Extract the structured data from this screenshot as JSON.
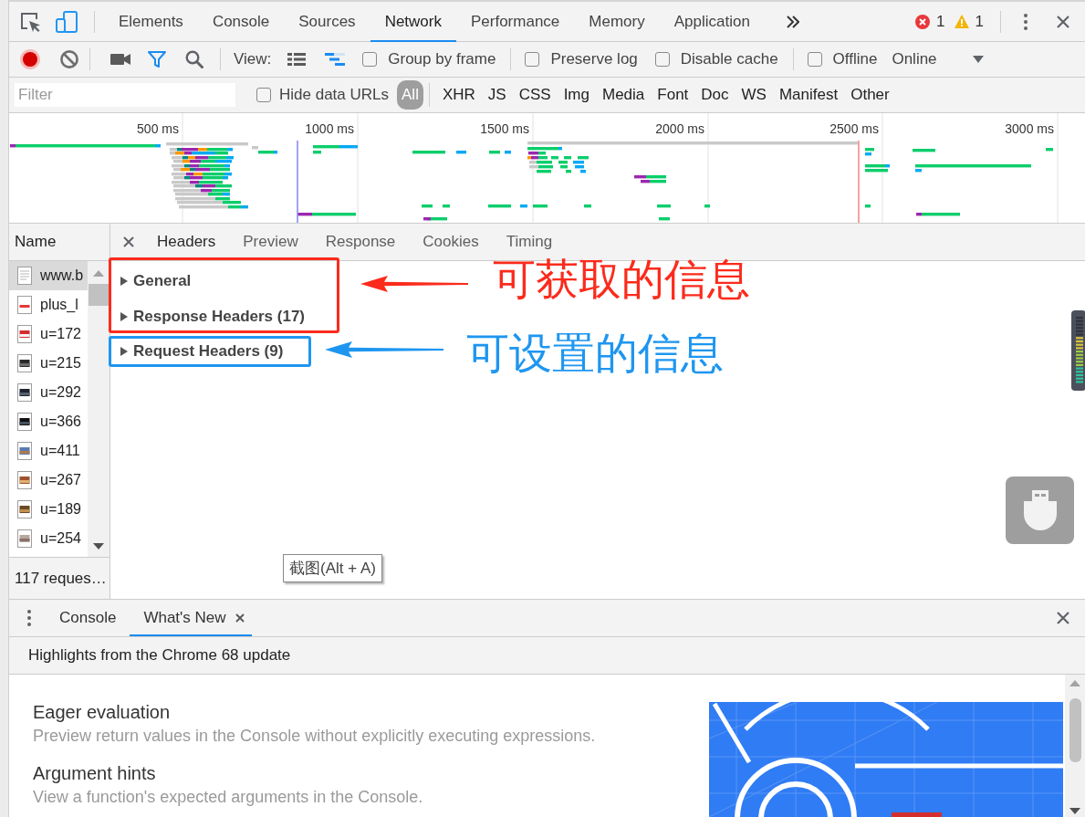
{
  "main_tabs": [
    {
      "label": "Elements",
      "selected": false
    },
    {
      "label": "Console",
      "selected": false
    },
    {
      "label": "Sources",
      "selected": false
    },
    {
      "label": "Network",
      "selected": true
    },
    {
      "label": "Performance",
      "selected": false
    },
    {
      "label": "Memory",
      "selected": false
    },
    {
      "label": "Application",
      "selected": false
    }
  ],
  "status": {
    "errors": "1",
    "warnings": "1"
  },
  "toolbar": {
    "recording": true,
    "filter_on": true,
    "view_label": "View:",
    "large_rows": false,
    "overview_on": true,
    "option_groups": [
      [
        {
          "label": "Group by frame",
          "checked": false
        }
      ],
      [
        {
          "label": "Preserve log",
          "checked": false
        },
        {
          "label": "Disable cache",
          "checked": false
        }
      ],
      [
        {
          "label": "Offline",
          "checked": false
        }
      ]
    ],
    "throttling": "Online"
  },
  "filter_bar": {
    "placeholder": "Filter",
    "hide_data_urls": {
      "label": "Hide data URLs",
      "checked": false
    },
    "types": [
      {
        "label": "All",
        "selected": true
      },
      {
        "label": "XHR",
        "selected": false
      },
      {
        "label": "JS",
        "selected": false
      },
      {
        "label": "CSS",
        "selected": false
      },
      {
        "label": "Img",
        "selected": false
      },
      {
        "label": "Media",
        "selected": false
      },
      {
        "label": "Font",
        "selected": false
      },
      {
        "label": "Doc",
        "selected": false
      },
      {
        "label": "WS",
        "selected": false
      },
      {
        "label": "Manifest",
        "selected": false
      },
      {
        "label": "Other",
        "selected": false
      }
    ]
  },
  "overview": {
    "ticks": [
      "500 ms",
      "1000 ms",
      "1500 ms",
      "2000 ms",
      "2500 ms",
      "3000 ms"
    ]
  },
  "requests": {
    "column": "Name",
    "items": [
      {
        "name": "www.b",
        "kind": "document",
        "selected": true
      },
      {
        "name": "plus_l",
        "kind": "image",
        "selected": false
      },
      {
        "name": "u=172",
        "kind": "image",
        "selected": false
      },
      {
        "name": "u=215",
        "kind": "image",
        "selected": false
      },
      {
        "name": "u=292",
        "kind": "image",
        "selected": false
      },
      {
        "name": "u=366",
        "kind": "image",
        "selected": false
      },
      {
        "name": "u=411",
        "kind": "image",
        "selected": false
      },
      {
        "name": "u=267",
        "kind": "image",
        "selected": false
      },
      {
        "name": "u=189",
        "kind": "image",
        "selected": false
      },
      {
        "name": "u=254",
        "kind": "image",
        "selected": false
      }
    ],
    "summary": "117 reques…"
  },
  "details": {
    "tabs": [
      {
        "label": "Headers",
        "selected": true
      },
      {
        "label": "Preview",
        "selected": false
      },
      {
        "label": "Response",
        "selected": false
      },
      {
        "label": "Cookies",
        "selected": false
      },
      {
        "label": "Timing",
        "selected": false
      }
    ],
    "annotation_groups": [
      {
        "color": "#fb2b1c",
        "label": "可获取的信息",
        "sections": [
          {
            "title": "General",
            "expanded": false
          },
          {
            "title": "Response Headers (17)",
            "expanded": false
          }
        ]
      },
      {
        "color": "#1e96f0",
        "label": "可设置的信息",
        "sections": [
          {
            "title": "Request Headers (9)",
            "expanded": false
          }
        ]
      }
    ]
  },
  "tooltip": "截图(Alt + A)",
  "drawer": {
    "tabs": [
      {
        "label": "Console",
        "selected": false,
        "closable": false
      },
      {
        "label": "What's New",
        "selected": true,
        "closable": true
      }
    ],
    "heading": "Highlights from the Chrome 68 update",
    "features": [
      {
        "title": "Eager evaluation",
        "description": "Preview return values in the Console without explicitly executing expressions."
      },
      {
        "title": "Argument hints",
        "description": "View a function's expected arguments in the Console."
      }
    ]
  }
}
